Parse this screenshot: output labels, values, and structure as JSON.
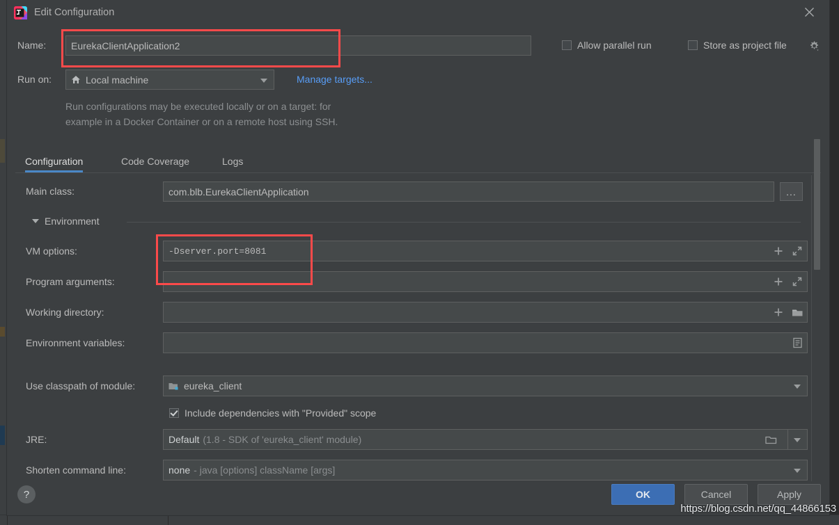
{
  "window": {
    "title": "Edit Configuration",
    "app_icon": "intellij-idea-icon",
    "close_icon": "close-icon"
  },
  "header": {
    "name_label": "Name:",
    "name_value": "EurekaClientApplication2",
    "run_on_label": "Run on:",
    "run_on_value": "Local machine",
    "run_on_icon": "home-icon",
    "manage_targets_link": "Manage targets...",
    "allow_parallel_run_label": "Allow parallel run",
    "allow_parallel_run_checked": false,
    "store_as_project_file_label": "Store as project file",
    "store_as_project_file_checked": false,
    "gear_icon": "gear-icon",
    "hint_line1": "Run configurations may be executed locally or on a target: for",
    "hint_line2": "example in a Docker Container or on a remote host using SSH."
  },
  "tabs": [
    {
      "label": "Configuration",
      "active": true
    },
    {
      "label": "Code Coverage",
      "active": false
    },
    {
      "label": "Logs",
      "active": false
    }
  ],
  "form": {
    "main_class_label": "Main class:",
    "main_class_value": "com.blb.EurekaClientApplication",
    "main_class_browse": "...",
    "environment_section_label": "Environment",
    "vm_options_label": "VM options:",
    "vm_options_value": "-Dserver.port=8081",
    "program_arguments_label": "Program arguments:",
    "program_arguments_value": "",
    "working_directory_label": "Working directory:",
    "working_directory_value": "",
    "environment_variables_label": "Environment variables:",
    "environment_variables_value": "",
    "use_classpath_label": "Use classpath of module:",
    "use_classpath_value": "eureka_client",
    "include_dependencies_label": "Include dependencies with \"Provided\" scope",
    "include_dependencies_checked": true,
    "jre_label": "JRE:",
    "jre_value_strong": "Default",
    "jre_value_dim": "(1.8 - SDK of 'eureka_client' module)",
    "shorten_label": "Shorten command line:",
    "shorten_value_strong": "none",
    "shorten_value_dim": "- java [options] className [args]"
  },
  "footer": {
    "help_label": "?",
    "ok_label": "OK",
    "cancel_label": "Cancel",
    "apply_label": "Apply"
  },
  "watermark": "https://blog.csdn.net/qq_44866153",
  "annotations": [
    {
      "name": "name-field-highlight"
    },
    {
      "name": "vm-options-highlight"
    }
  ],
  "colors": {
    "dialog_background": "#3c3f41",
    "ide_background": "#2b2b2b",
    "accent_blue": "#4a88c7",
    "link_blue": "#589df6",
    "primary_button": "#3c6eb4",
    "annotation_red": "#fb4a4a",
    "field_background": "#45494a"
  }
}
